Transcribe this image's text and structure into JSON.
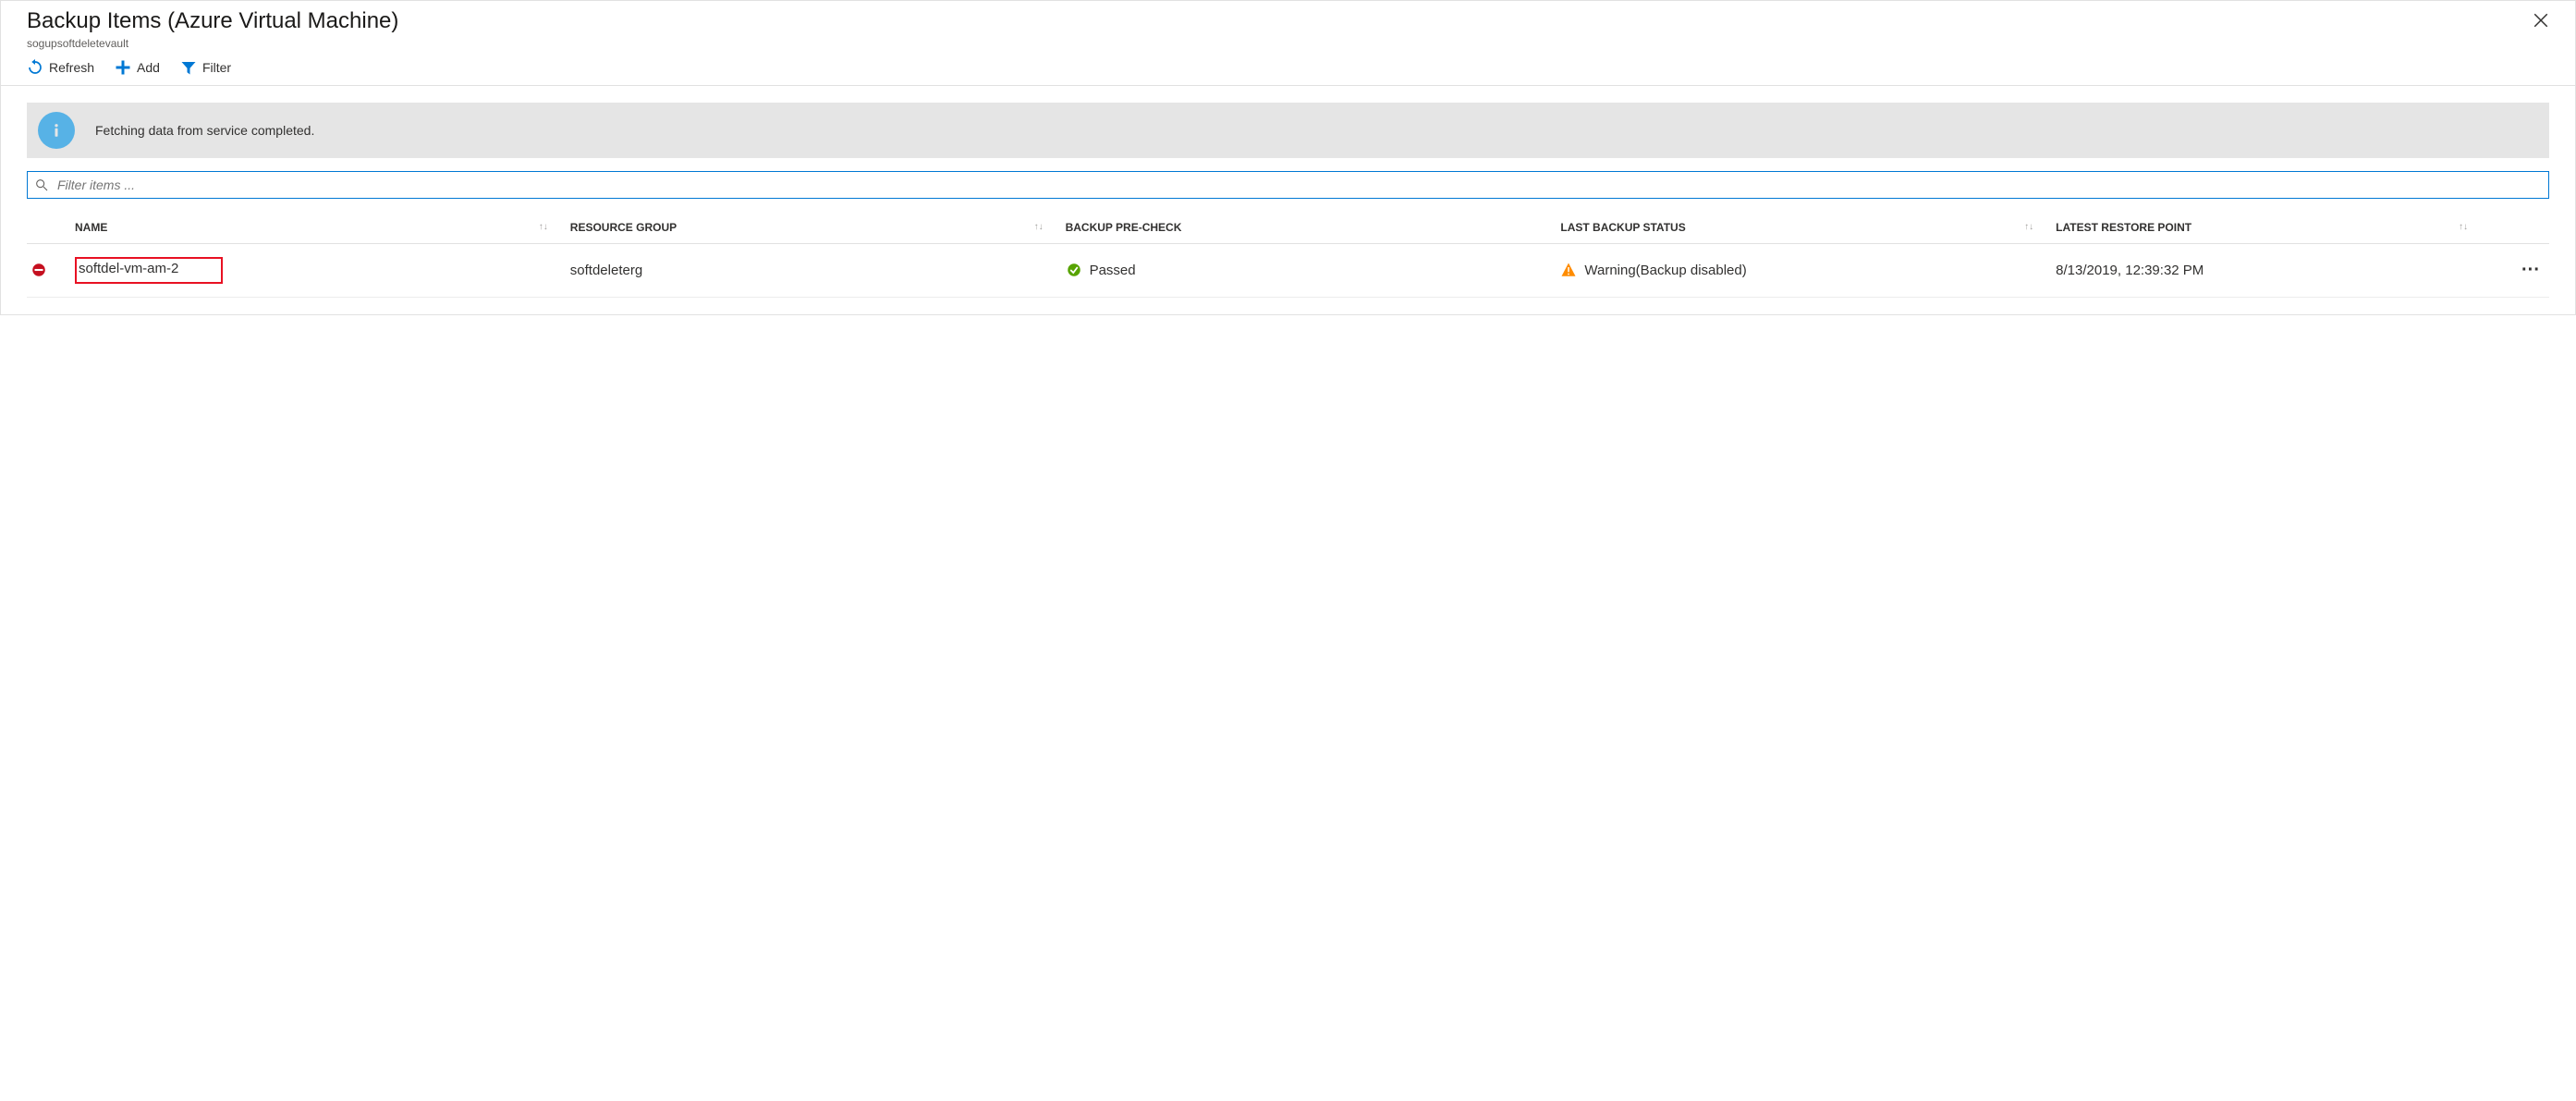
{
  "header": {
    "title": "Backup Items (Azure Virtual Machine)",
    "subtitle": "sogupsoftdeletevault"
  },
  "toolbar": {
    "refresh": "Refresh",
    "add": "Add",
    "filter": "Filter"
  },
  "message": {
    "text": "Fetching data from service completed."
  },
  "filter": {
    "placeholder": "Filter items ..."
  },
  "columns": {
    "name": "NAME",
    "resource_group": "RESOURCE GROUP",
    "backup_precheck": "BACKUP PRE-CHECK",
    "last_backup_status": "LAST BACKUP STATUS",
    "latest_restore_point": "LATEST RESTORE POINT"
  },
  "rows": [
    {
      "name": "softdel-vm-am-2",
      "resource_group": "softdeleterg",
      "precheck": "Passed",
      "last_backup_status": "Warning(Backup disabled)",
      "latest_restore_point": "8/13/2019, 12:39:32 PM"
    }
  ],
  "colors": {
    "accent": "#0078d4",
    "success": "#57a300",
    "warning": "#ff8c00",
    "error": "#c50f1f",
    "highlight": "#e81123"
  }
}
